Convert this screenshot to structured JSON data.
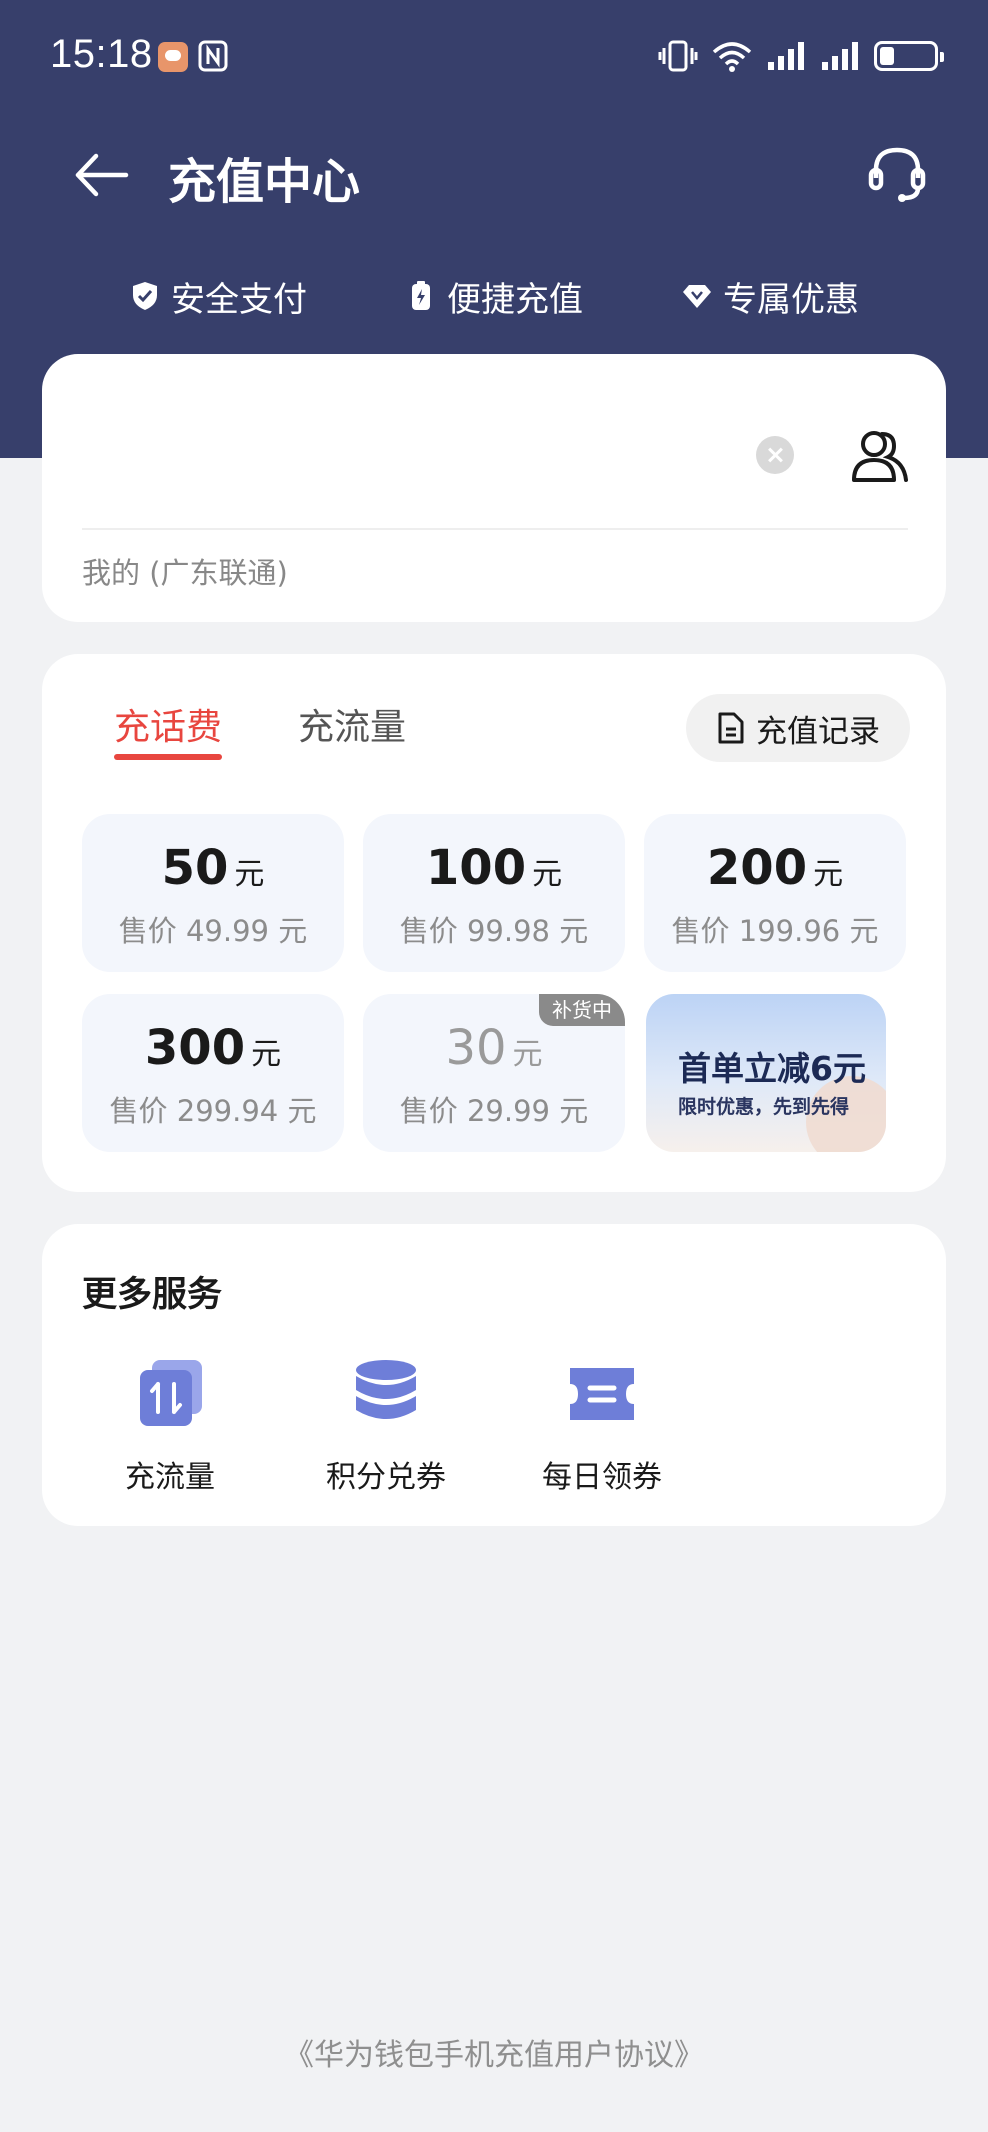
{
  "status_bar": {
    "time": "15:18"
  },
  "header": {
    "title": "充值中心",
    "features": [
      {
        "label": "安全支付",
        "icon": "shield-icon"
      },
      {
        "label": "便捷充值",
        "icon": "battery-bolt-icon"
      },
      {
        "label": "专属优惠",
        "icon": "diamond-icon"
      }
    ]
  },
  "phone": {
    "number": "",
    "carrier": "我的 (广东联通)"
  },
  "recharge": {
    "tabs": [
      {
        "label": "充话费",
        "active": true
      },
      {
        "label": "充流量",
        "active": false
      }
    ],
    "history_label": "充值记录",
    "amounts": [
      {
        "value": "50",
        "unit": "元",
        "price": "售价 49.99 元"
      },
      {
        "value": "100",
        "unit": "元",
        "price": "售价 99.98 元"
      },
      {
        "value": "200",
        "unit": "元",
        "price": "售价 199.96 元"
      },
      {
        "value": "300",
        "unit": "元",
        "price": "售价 299.94 元"
      },
      {
        "value": "30",
        "unit": "元",
        "price": "售价 29.99 元",
        "badge": "补货中",
        "disabled": true
      }
    ],
    "promo": {
      "title": "首单立减6元",
      "subtitle": "限时优惠，先到先得"
    }
  },
  "services": {
    "title": "更多服务",
    "items": [
      {
        "label": "充流量",
        "icon": "data-transfer-icon"
      },
      {
        "label": "积分兑券",
        "icon": "coins-stack-icon"
      },
      {
        "label": "每日领券",
        "icon": "ticket-icon"
      }
    ]
  },
  "footer": {
    "agreement": "《华为钱包手机充值用户协议》"
  },
  "colors": {
    "header_bg": "#373f6b",
    "accent_red": "#e8463f",
    "icon_blue": "#6e7ed8",
    "page_bg": "#f1f2f4"
  }
}
